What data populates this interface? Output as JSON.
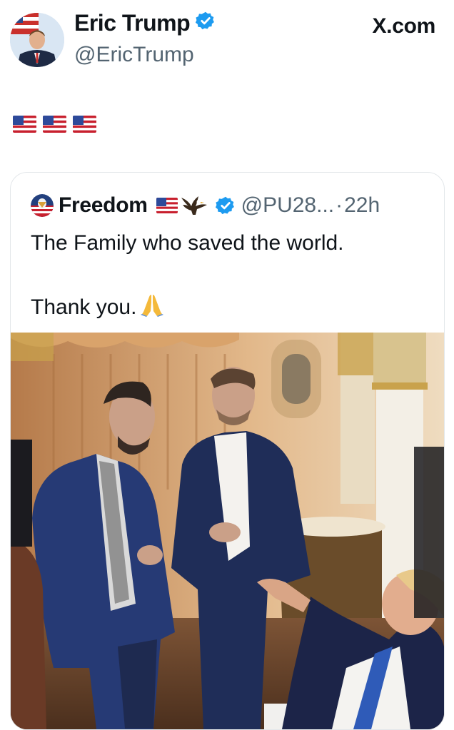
{
  "author": {
    "name": "Eric Trump",
    "handle": "@EricTrump",
    "verified": true,
    "verified_color": "#1d9bf0"
  },
  "site_label": "X.com",
  "post": {
    "text_emojis": [
      "flag-us",
      "flag-us",
      "flag-us"
    ]
  },
  "quoted_post": {
    "name": "Freedom",
    "name_emojis": [
      "flag-us",
      "eagle"
    ],
    "handle": "@PU28...",
    "separator": "·",
    "time": "22h",
    "verified": true,
    "text": "The Family who saved the world.\n\nThank you.",
    "text_emoji": "folded-hands",
    "media": {
      "type": "photo",
      "icon": "photo-icon"
    }
  },
  "colors": {
    "text": "#0f1419",
    "secondary": "#536471",
    "border": "#e3e7ea"
  }
}
